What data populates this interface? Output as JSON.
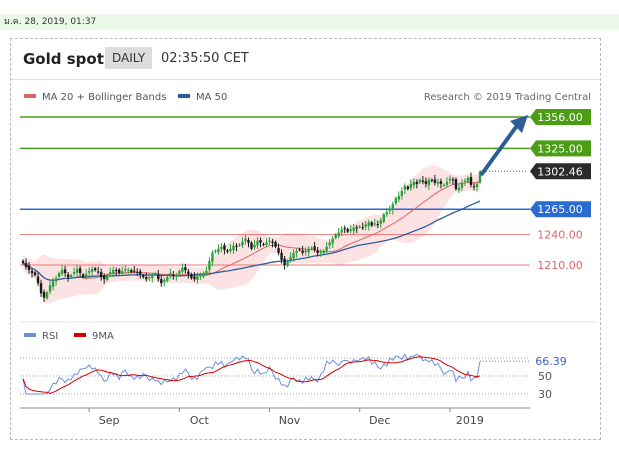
{
  "timestamp": "ม.ค. 28, 2019, 01:37",
  "header": {
    "instrument": "Gold spot",
    "period": "DAILY",
    "time": "02:35:50 CET"
  },
  "legend": {
    "ma20": "MA 20 + Bollinger Bands",
    "ma50": "MA 50",
    "credit": "Research © 2019 Trading Central"
  },
  "colors": {
    "green": "#4a9d14",
    "blue": "#2a6bd1",
    "red": "#e36464",
    "bull": "#1a1a1a",
    "band": "#fbd3d3",
    "ma50": "#2f5e9e",
    "dark": "#2b2b2b",
    "rsi": "#6c8fd8",
    "rsi_ma": "#d00000"
  },
  "price_levels": [
    {
      "value": 1356.0,
      "label": "1356.00",
      "kind": "target"
    },
    {
      "value": 1325.0,
      "label": "1325.00",
      "kind": "resistance"
    },
    {
      "value": 1302.46,
      "label": "1302.46",
      "kind": "last"
    },
    {
      "value": 1265.0,
      "label": "1265.00",
      "kind": "pivot"
    },
    {
      "value": 1240.0,
      "label": "1240.00",
      "kind": "support"
    },
    {
      "value": 1210.0,
      "label": "1210.00",
      "kind": "support"
    }
  ],
  "rsi": {
    "label": "RSI",
    "ma_label": "9MA",
    "value_label": "66.39",
    "value": 66.39,
    "ticks": [
      {
        "value": 50,
        "label": "50"
      },
      {
        "value": 30,
        "label": "30"
      }
    ]
  },
  "x_labels": [
    "Sep",
    "Oct",
    "Nov",
    "Dec",
    "2019"
  ],
  "chart_data": {
    "type": "candlestick",
    "y_range": [
      1168,
      1368
    ],
    "months": [
      {
        "label": "Sep",
        "index": 22
      },
      {
        "label": "Oct",
        "index": 52
      },
      {
        "label": "Nov",
        "index": 82
      },
      {
        "label": "Dec",
        "index": 112
      },
      {
        "label": "2019",
        "index": 142
      }
    ],
    "close": [
      1212,
      1208,
      1205,
      1202,
      1200,
      1192,
      1182,
      1178,
      1183,
      1190,
      1194,
      1197,
      1202,
      1205,
      1202,
      1198,
      1200,
      1203,
      1206,
      1202,
      1198,
      1201,
      1204,
      1206,
      1205,
      1203,
      1198,
      1196,
      1200,
      1203,
      1205,
      1204,
      1202,
      1204,
      1206,
      1205,
      1203,
      1204,
      1203,
      1201,
      1198,
      1196,
      1198,
      1200,
      1202,
      1196,
      1192,
      1195,
      1198,
      1202,
      1199,
      1200,
      1204,
      1207,
      1205,
      1201,
      1197,
      1196,
      1199,
      1200,
      1202,
      1204,
      1214,
      1222,
      1224,
      1226,
      1228,
      1225,
      1223,
      1226,
      1229,
      1228,
      1230,
      1233,
      1236,
      1232,
      1226,
      1230,
      1234,
      1232,
      1230,
      1232,
      1234,
      1232,
      1228,
      1222,
      1215,
      1210,
      1214,
      1218,
      1222,
      1224,
      1225,
      1222,
      1224,
      1226,
      1227,
      1225,
      1222,
      1223,
      1224,
      1228,
      1232,
      1236,
      1240,
      1242,
      1245,
      1246,
      1243,
      1245,
      1247,
      1246,
      1248,
      1247,
      1250,
      1252,
      1249,
      1251,
      1250,
      1254,
      1260,
      1262,
      1265,
      1270,
      1276,
      1278,
      1283,
      1288,
      1285,
      1290,
      1292,
      1290,
      1294,
      1292,
      1290,
      1294,
      1293,
      1291,
      1292,
      1290,
      1289,
      1292,
      1295,
      1294,
      1285,
      1286,
      1291,
      1293,
      1296,
      1289,
      1287,
      1290,
      1302
    ]
  }
}
